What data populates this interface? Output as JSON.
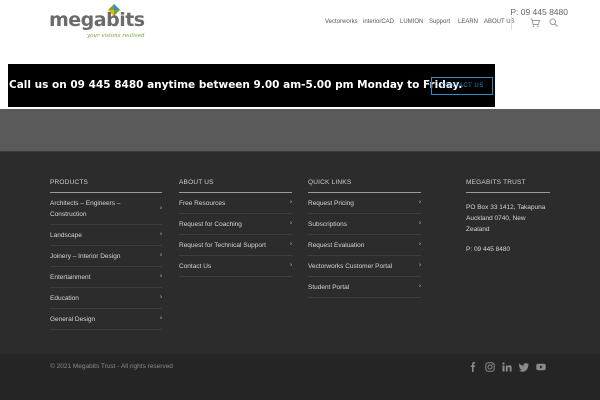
{
  "header": {
    "logo_text": "megabits",
    "logo_tagline": "your visions realised",
    "phone": "P: 09 445 8480",
    "nav": [
      {
        "label": "Vectorworks"
      },
      {
        "label": "interiorCAD"
      },
      {
        "label": "LUMION"
      },
      {
        "label": "Support"
      },
      {
        "label": "LEARN"
      },
      {
        "label": "ABOUT US"
      }
    ],
    "icons": [
      "cart-icon",
      "search-icon"
    ]
  },
  "banner": {
    "text": "Call us on 09 445 8480 anytime between 9.00 am-5.00 pm Monday to Friday.",
    "button_label": "CONTACT US",
    "button_color": "#2a8ecf"
  },
  "footer": {
    "products": {
      "title": "PRODUCTS",
      "items": [
        "Architects – Engineers – Construction",
        "Landscape",
        "Joinery – Interior Design",
        "Entertainment",
        "Education",
        "General Design"
      ]
    },
    "about": {
      "title": "ABOUT US",
      "items": [
        "Free Resources",
        "Request for Coaching",
        "Request for Technical Support",
        "Contact Us"
      ]
    },
    "quick_links": {
      "title": "QUICK LINKS",
      "items": [
        "Request Pricing",
        "Subscriptions",
        "Request Evaluation",
        "Vectorworks Customer Portal",
        "Student Portal"
      ]
    },
    "trust": {
      "title": "MEGABITS TRUST",
      "address": "PO Box 33 1412, Takapuna Auckland 0740, New Zealand",
      "phone": "P: 09 445 8480"
    }
  },
  "bottom": {
    "copyright": "© 2021 Megabits Trust - All rights reserved",
    "social": [
      "facebook-icon",
      "instagram-icon",
      "linkedin-icon",
      "twitter-icon",
      "youtube-icon"
    ]
  },
  "colors": {
    "footer_bg": "#2c2c2c",
    "bottom_bg": "#252525",
    "gray_band": "#5a5a5a",
    "logo_green": "#7aa33a"
  }
}
